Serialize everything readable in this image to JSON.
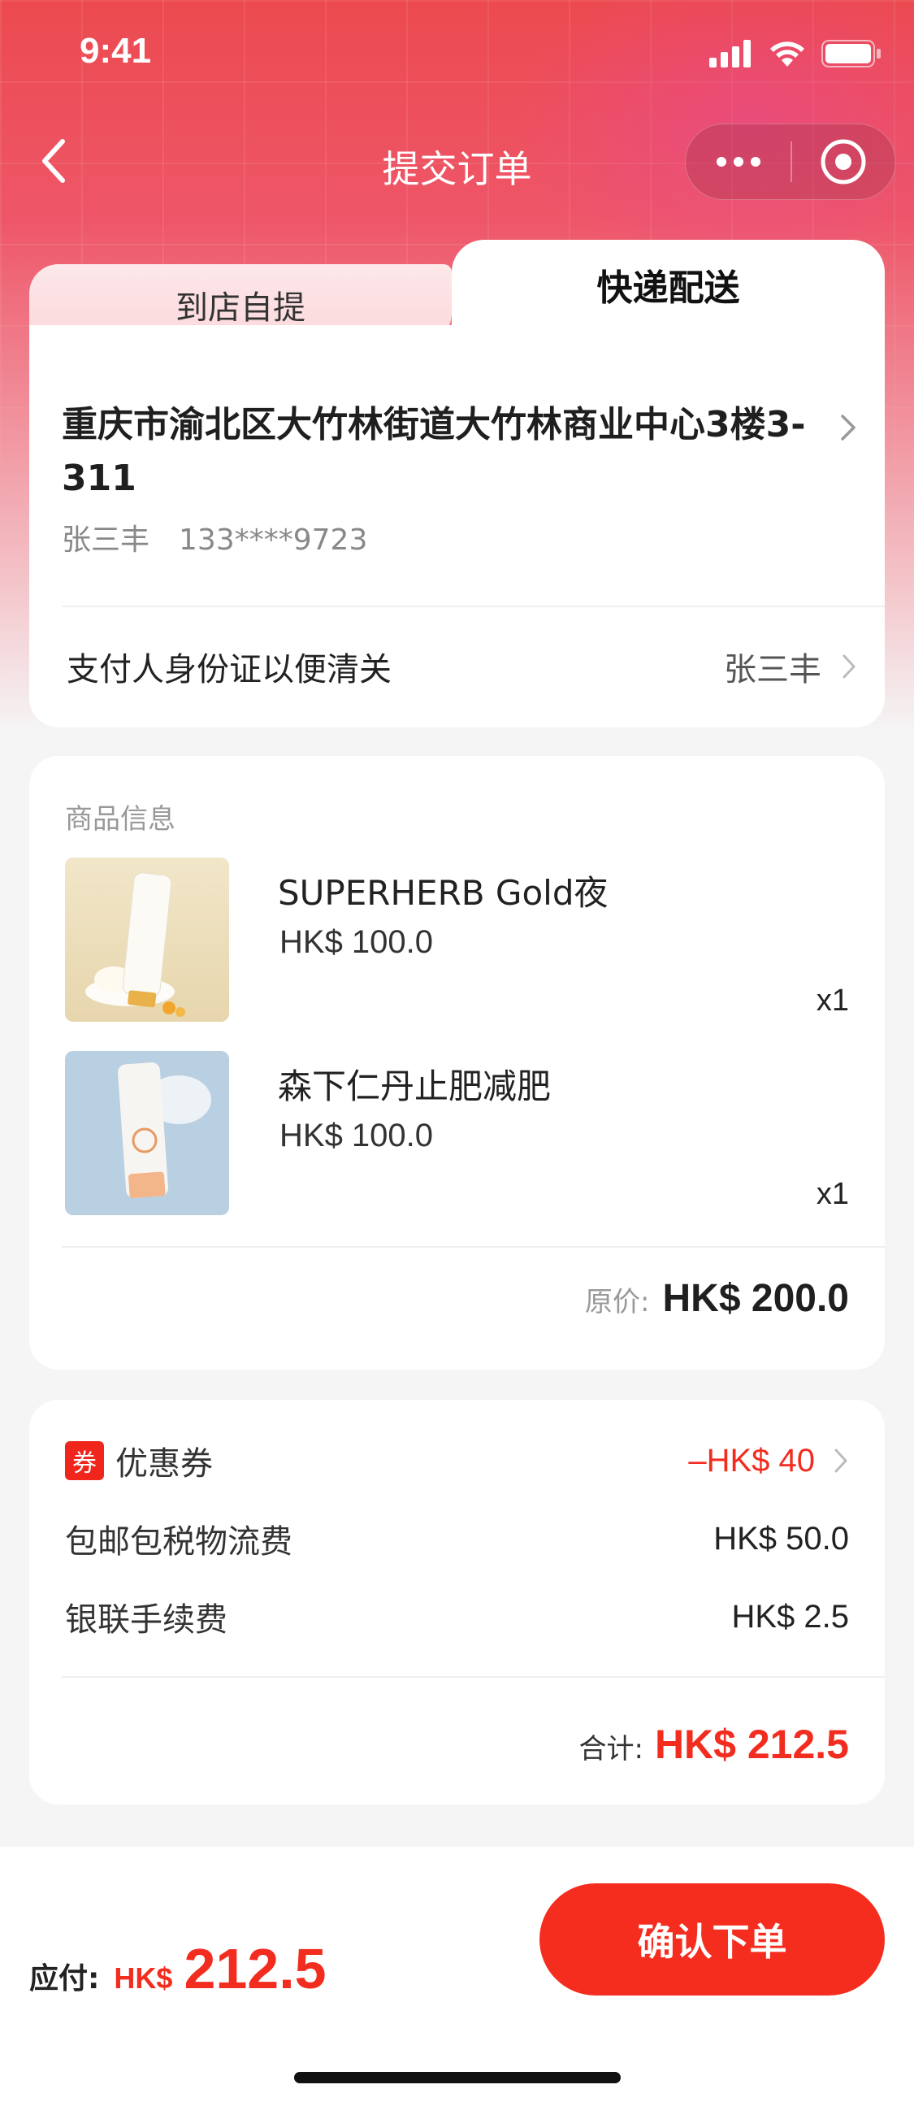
{
  "status_bar": {
    "time": "9:41"
  },
  "nav": {
    "title": "提交订单"
  },
  "tabs": {
    "pickup_label": "到店自提",
    "delivery_label": "快递配送",
    "active": "delivery"
  },
  "address": {
    "text": "重庆市渝北区大竹林街道大竹林商业中心3楼3-311",
    "name": "张三丰",
    "phone": "133****9723"
  },
  "payer": {
    "label": "支付人身份证以便清关",
    "value": "张三丰"
  },
  "goods": {
    "title": "商品信息",
    "items": [
      {
        "name": "SUPERHERB Gold夜",
        "price": "HK$ 100.0",
        "qty": "x1",
        "image": "cream-tube-yellow"
      },
      {
        "name": "森下仁丹止肥减肥",
        "price": "HK$ 100.0",
        "qty": "x1",
        "image": "cream-tube-blue"
      }
    ],
    "original_label": "原价:",
    "original_value": "HK$ 200.0"
  },
  "fees": {
    "coupon_badge": "券",
    "coupon_label": "优惠券",
    "coupon_value": "–HK$ 40",
    "shipping_label": "包邮包税物流费",
    "shipping_value": "HK$ 50.0",
    "unionpay_label": "银联手续费",
    "unionpay_value": "HK$ 2.5",
    "total_label": "合计:",
    "total_value": "HK$ 212.5"
  },
  "bottom": {
    "pay_label": "应付:",
    "pay_currency": "HK$",
    "pay_amount": "212.5",
    "confirm_label": "确认下单"
  },
  "colors": {
    "accent": "#f52d1f",
    "header": "#ec4a4f"
  }
}
